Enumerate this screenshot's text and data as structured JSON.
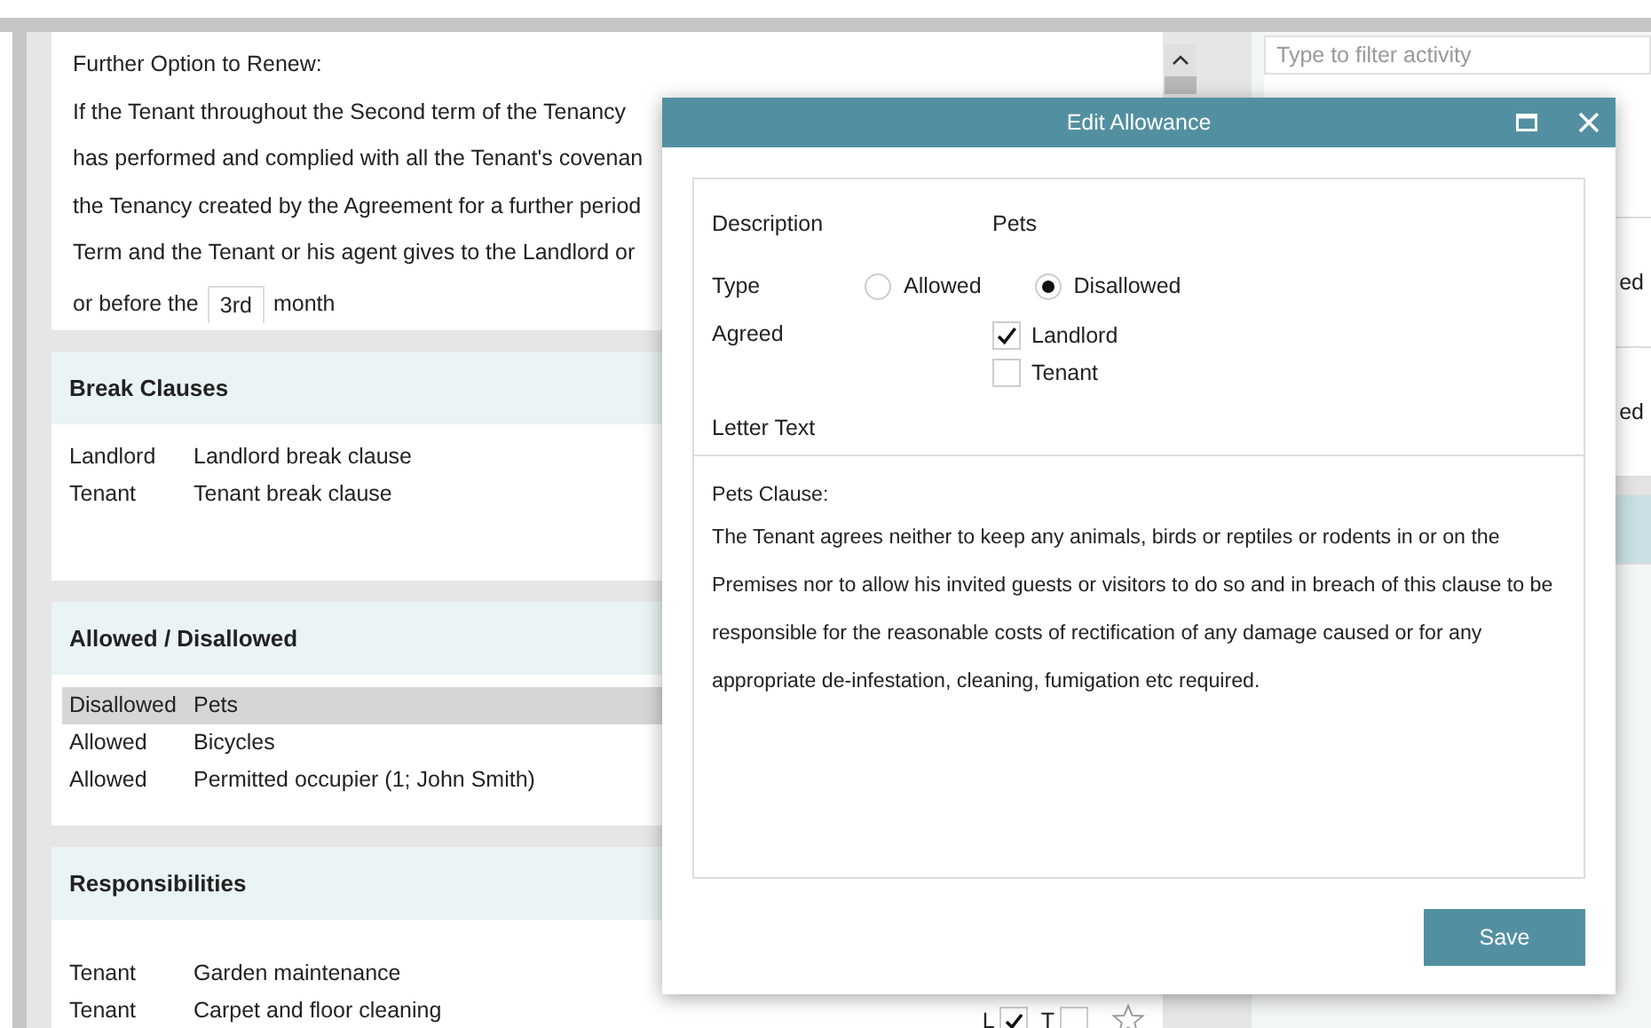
{
  "option_card": {
    "lines": [
      "Further Option to Renew:",
      "If the Tenant throughout the Second term of the Tenancy",
      "has performed and complied with all the Tenant's covenan",
      "the Tenancy created by the Agreement for a further period",
      "Term and the Tenant or his agent gives to the Landlord or"
    ],
    "before": "or before the",
    "value": "3rd",
    "after": "month"
  },
  "sections": [
    {
      "title": "Break Clauses",
      "rows": [
        {
          "party": "Landlord",
          "item": "Landlord break clause",
          "selected": false
        },
        {
          "party": "Tenant",
          "item": "Tenant break clause",
          "selected": false
        }
      ]
    },
    {
      "title": "Allowed / Disallowed",
      "rows": [
        {
          "party": "Disallowed",
          "item": "Pets",
          "selected": true
        },
        {
          "party": "Allowed",
          "item": "Bicycles",
          "selected": false
        },
        {
          "party": "Allowed",
          "item": "Permitted occupier (1; John Smith)",
          "selected": false
        }
      ]
    },
    {
      "title": "Responsibilities",
      "rows": [
        {
          "party": "Tenant",
          "item": "Garden maintenance",
          "selected": false
        },
        {
          "party": "Tenant",
          "item": "Carpet and floor cleaning",
          "selected": false,
          "flags": {
            "landlord_label": "L",
            "landlord": true,
            "tenant_label": "T",
            "tenant": false
          }
        }
      ]
    }
  ],
  "activity": {
    "filter_placeholder": "Type to filter activity",
    "items": [
      {
        "selected": false
      },
      {
        "status": "ed",
        "selected": false
      },
      {
        "status": "ed",
        "selected": false
      },
      {
        "selected": true
      }
    ]
  },
  "dialog": {
    "title": "Edit Allowance",
    "description_label": "Description",
    "description": "Pets",
    "type_label": "Type",
    "types": [
      {
        "label": "Allowed",
        "selected": false
      },
      {
        "label": "Disallowed",
        "selected": true
      }
    ],
    "agreed_label": "Agreed",
    "agreed": [
      {
        "label": "Landlord",
        "checked": true
      },
      {
        "label": "Tenant",
        "checked": false
      }
    ],
    "letter_label": "Letter Text",
    "letter_heading": "Pets Clause:",
    "letter_body": "The Tenant agrees neither to keep any animals, birds or reptiles or rodents in or on the Premises nor to allow his invited guests or visitors to do so and in breach of this clause to be responsible for the reasonable costs of rectification of any damage caused or for any appropriate de-infestation, cleaning, fumigation etc required.",
    "save": "Save"
  }
}
